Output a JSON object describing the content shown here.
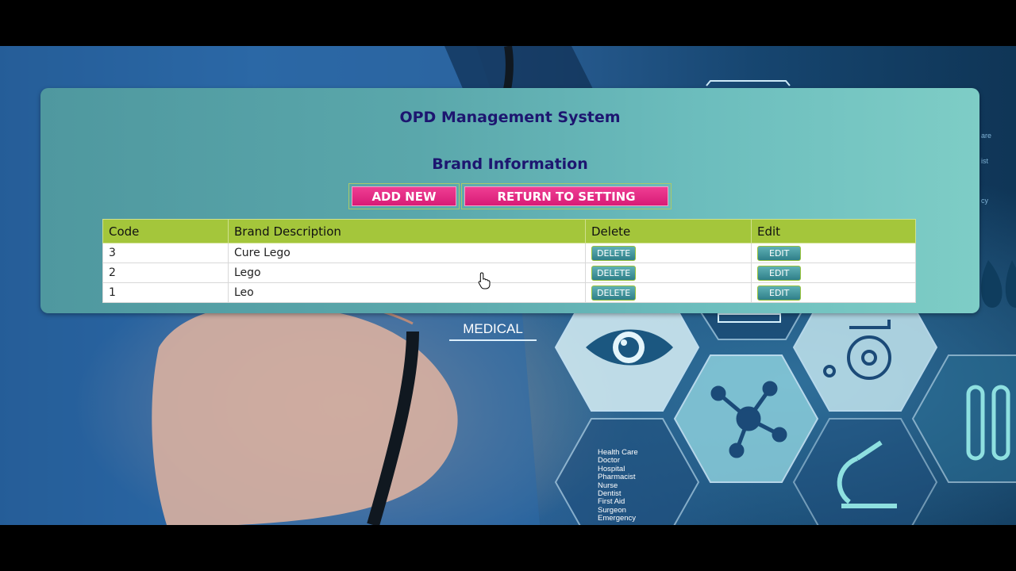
{
  "app": {
    "system_title": "OPD Management System",
    "page_title": "Brand Information"
  },
  "toolbar": {
    "add_new_label": "ADD NEW",
    "return_label": "RETURN TO SETTING"
  },
  "table": {
    "headers": [
      "Code",
      "Brand Description",
      "Delete",
      "Edit"
    ],
    "rows": [
      {
        "code": "3",
        "description": "Cure Lego",
        "delete_label": "DELETE",
        "edit_label": "EDIT"
      },
      {
        "code": "2",
        "description": "Lego",
        "delete_label": "DELETE",
        "edit_label": "EDIT"
      },
      {
        "code": "1",
        "description": "Leo",
        "delete_label": "DELETE",
        "edit_label": "EDIT"
      }
    ]
  },
  "background": {
    "medical_label": "MEDICAL",
    "health_terms": [
      "Health Care",
      "Doctor",
      "Hospital",
      "Pharmacist",
      "Nurse",
      "Dentist",
      "First Aid",
      "Surgeon",
      "Emergency"
    ],
    "right_fragments": [
      "are",
      "ist",
      "cy"
    ]
  },
  "colors": {
    "title": "#1d1670",
    "button_pink": "#d81b76",
    "header_green": "#a4c63b",
    "small_button_teal": "#2f7f89"
  }
}
